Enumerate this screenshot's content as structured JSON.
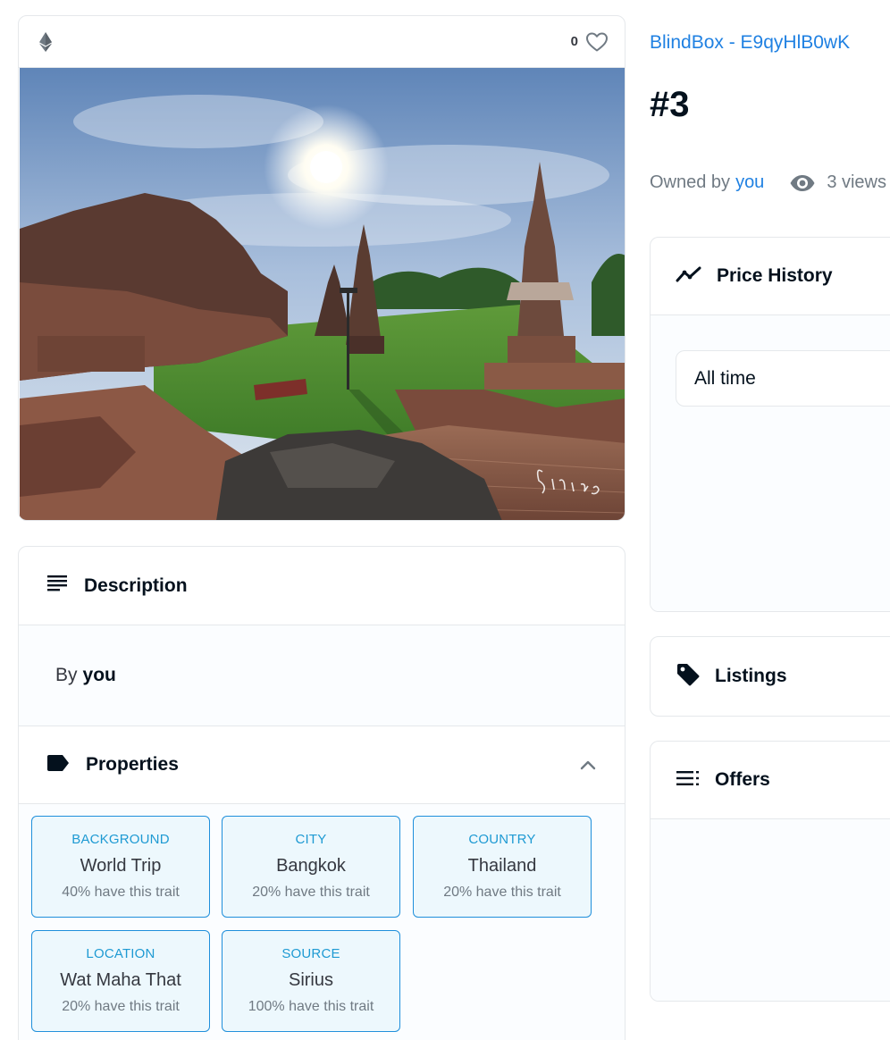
{
  "media": {
    "favorites_count": "0",
    "chain_icon": "ethereum-icon",
    "favorite_icon": "heart-outline-icon",
    "image_alt": "Ancient temple ruins with stupas under a bright sun",
    "watermark_signature": "Sirius"
  },
  "description": {
    "title": "Description",
    "by_label": "By",
    "by_name": "you"
  },
  "properties": {
    "title": "Properties",
    "traits": [
      {
        "type": "BACKGROUND",
        "value": "World Trip",
        "rarity": "40% have this trait"
      },
      {
        "type": "CITY",
        "value": "Bangkok",
        "rarity": "20% have this trait"
      },
      {
        "type": "COUNTRY",
        "value": "Thailand",
        "rarity": "20% have this trait"
      },
      {
        "type": "LOCATION",
        "value": "Wat Maha That",
        "rarity": "20% have this trait"
      },
      {
        "type": "SOURCE",
        "value": "Sirius",
        "rarity": "100% have this trait"
      }
    ]
  },
  "item": {
    "collection": "BlindBox - E9qyHlB0wK",
    "name": "#3",
    "owned_by_label": "Owned by",
    "owner": "you",
    "views": "3 views"
  },
  "price_history": {
    "title": "Price History",
    "range_selected": "All time"
  },
  "listings": {
    "title": "Listings"
  },
  "offers": {
    "title": "Offers"
  },
  "colors": {
    "accent_blue": "#2081e2",
    "trait_border": "#1f8fdb",
    "text_dark": "#04111d",
    "text_muted": "#707a83"
  }
}
